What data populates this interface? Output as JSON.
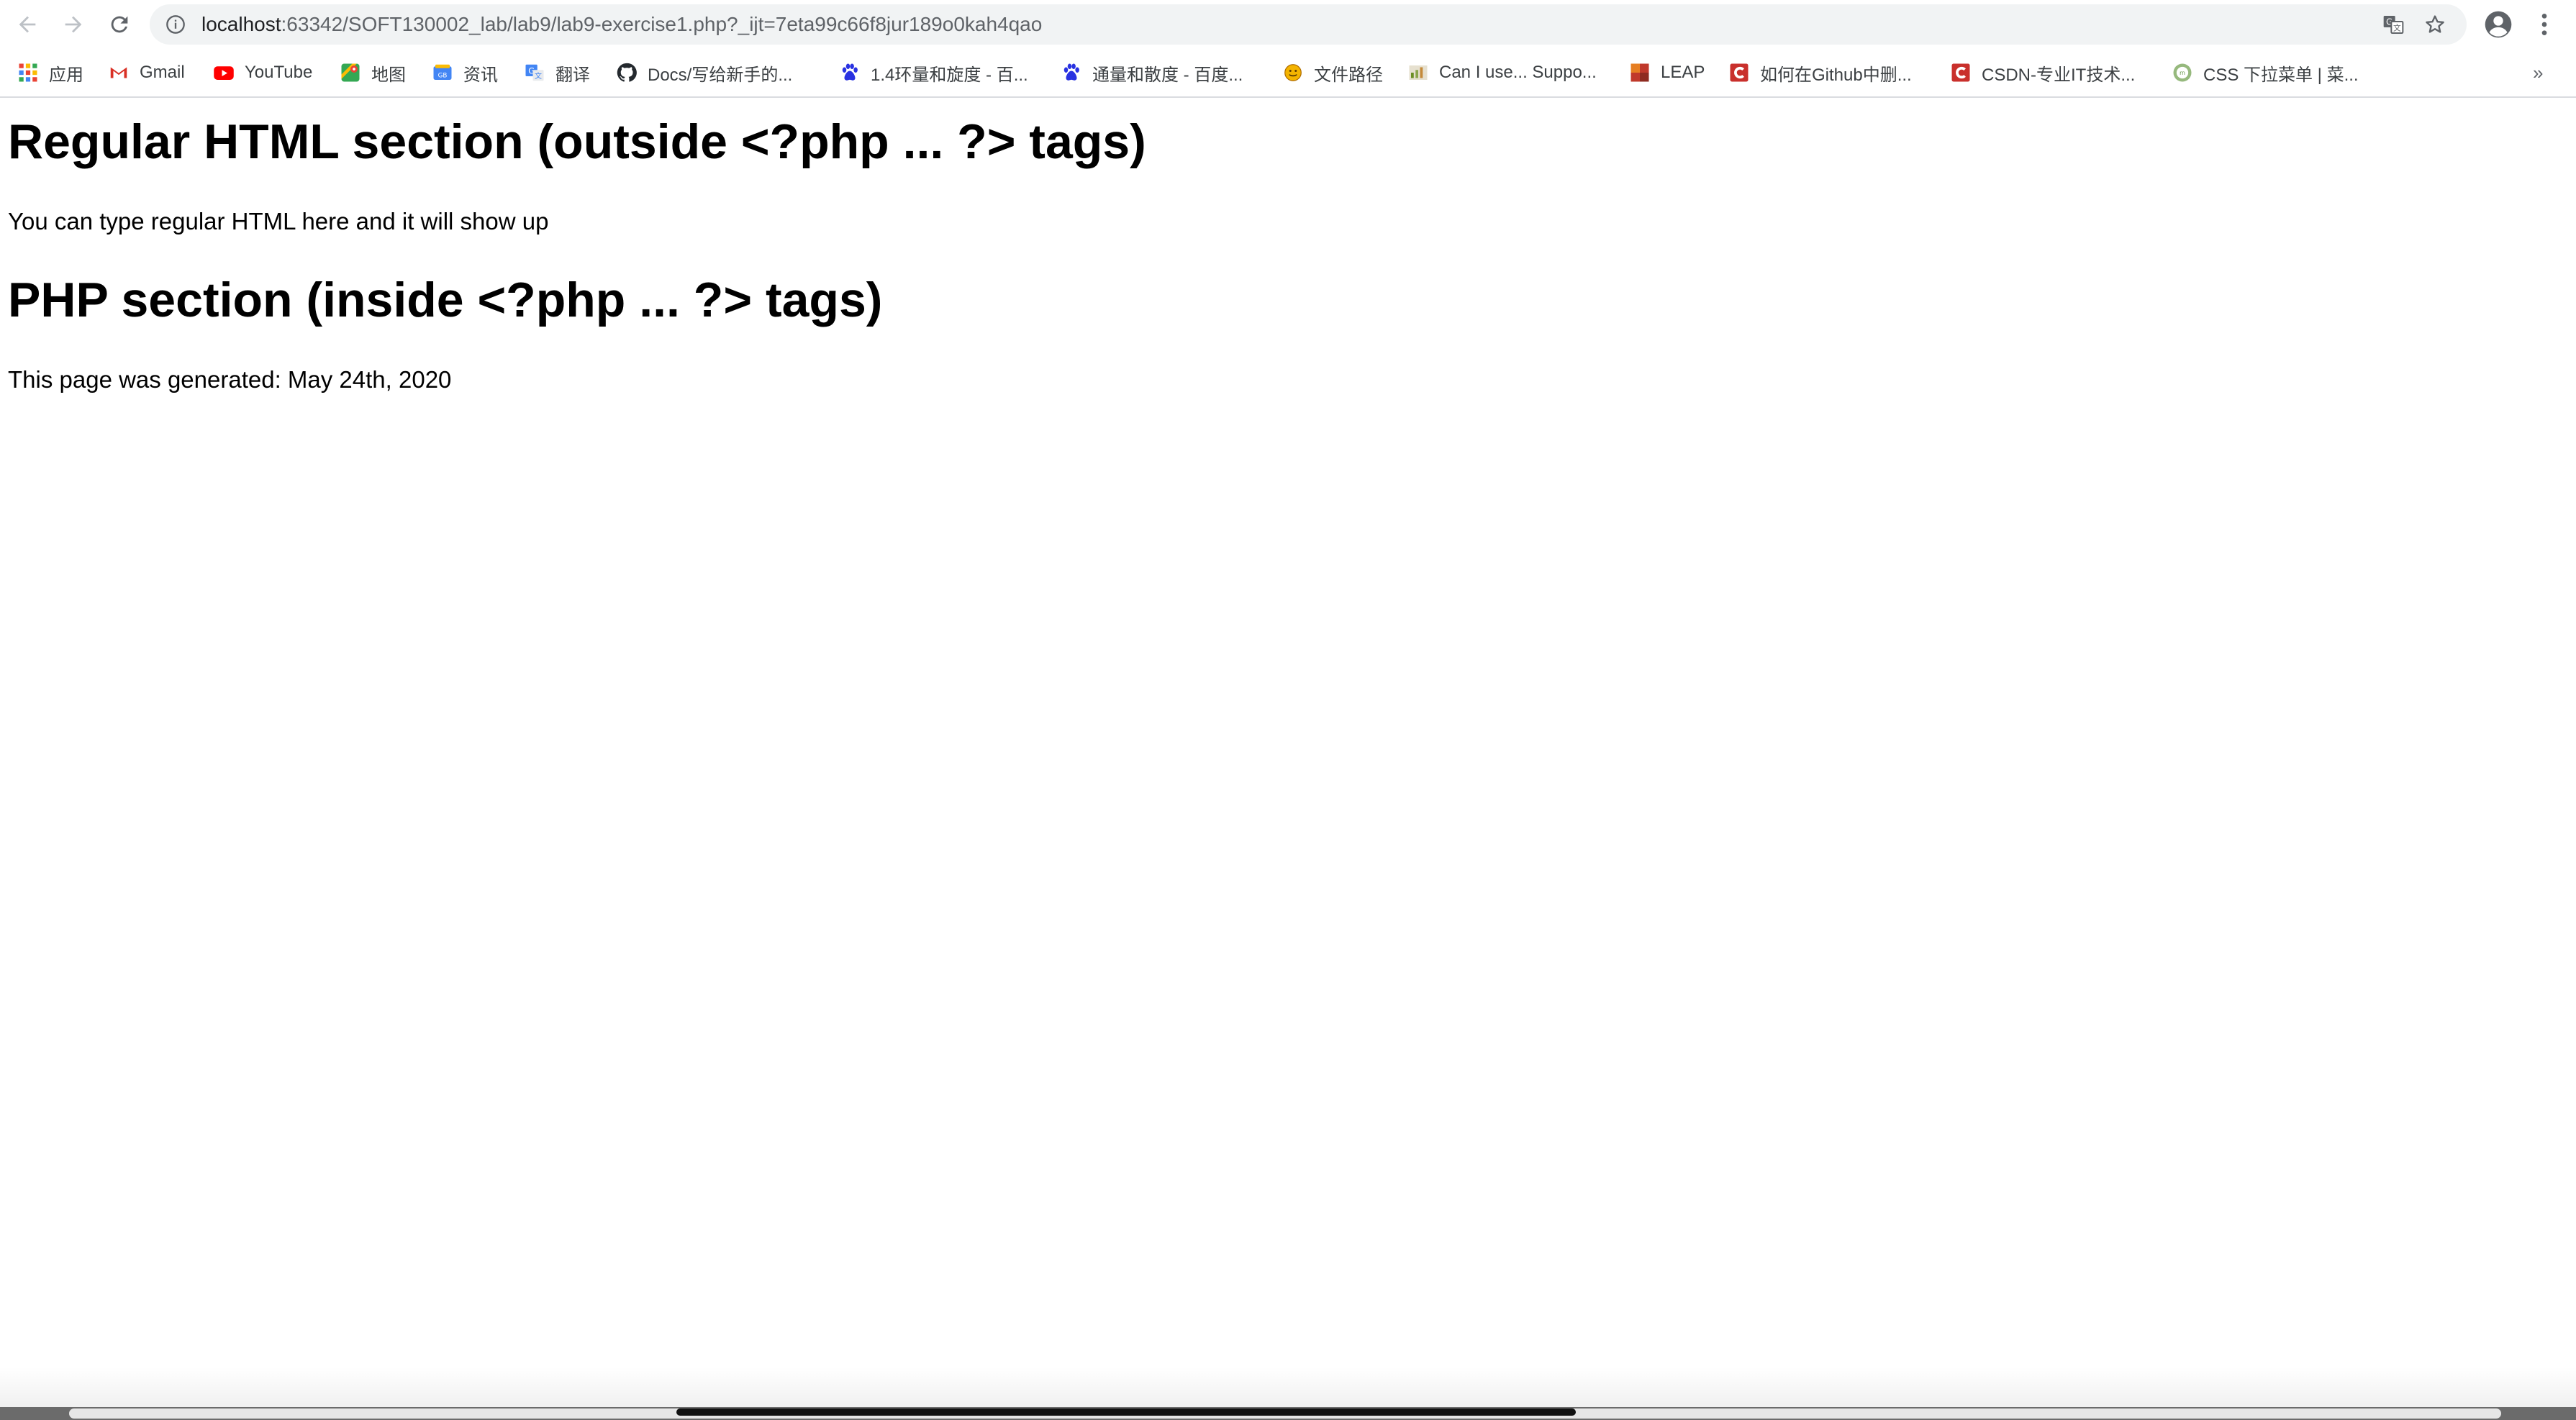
{
  "browser": {
    "url": {
      "host": "localhost",
      "rest": ":63342/SOFT130002_lab/lab9/lab9-exercise1.php?_ijt=7eta99c66f8jur189o0kah4qao"
    },
    "icons": {
      "back": "arrow-left-icon",
      "forward": "arrow-right-icon",
      "reload": "reload-icon",
      "info": "info-icon",
      "translate": "translate-icon",
      "bookmark": "star-icon",
      "profile": "account-icon",
      "menu": "more-vertical-icon"
    }
  },
  "bookmarks": {
    "items": [
      {
        "label": "应用",
        "icon": "apps-grid-icon"
      },
      {
        "label": "Gmail",
        "icon": "gmail-icon"
      },
      {
        "label": "YouTube",
        "icon": "youtube-icon"
      },
      {
        "label": "地图",
        "icon": "maps-icon"
      },
      {
        "label": "资讯",
        "icon": "news-icon"
      },
      {
        "label": "翻译",
        "icon": "translate-icon"
      },
      {
        "label": "Docs/写给新手的...",
        "icon": "github-icon"
      },
      {
        "label": "1.4环量和旋度 - 百...",
        "icon": "baidu-paw-icon"
      },
      {
        "label": "通量和散度 - 百度...",
        "icon": "baidu-paw-icon"
      },
      {
        "label": "文件路径",
        "icon": "smiley-icon"
      },
      {
        "label": "Can I use... Suppo...",
        "icon": "caniuse-icon"
      },
      {
        "label": "LEAP",
        "icon": "leap-icon"
      },
      {
        "label": "如何在Github中删...",
        "icon": "csdn-icon"
      },
      {
        "label": "CSDN-专业IT技术...",
        "icon": "csdn-icon"
      },
      {
        "label": "CSS 下拉菜单 | 菜...",
        "icon": "runoob-icon"
      }
    ],
    "more": "»"
  },
  "page": {
    "heading1": "Regular HTML section (outside <?php ... ?> tags)",
    "paragraph1": "You can type regular HTML here and it will show up",
    "heading2": "PHP section (inside <?php ... ?> tags)",
    "paragraph2": "This page was generated: May 24th, 2020"
  },
  "colors": {
    "omnibox_bg": "#f1f3f4",
    "toolbar_icon": "#5f6368",
    "gmail_red": "#d93025",
    "youtube_red": "#ff0000",
    "baidu_blue": "#2932e1",
    "csdn_red": "#c9302c",
    "leap_orange": "#c0392b"
  }
}
